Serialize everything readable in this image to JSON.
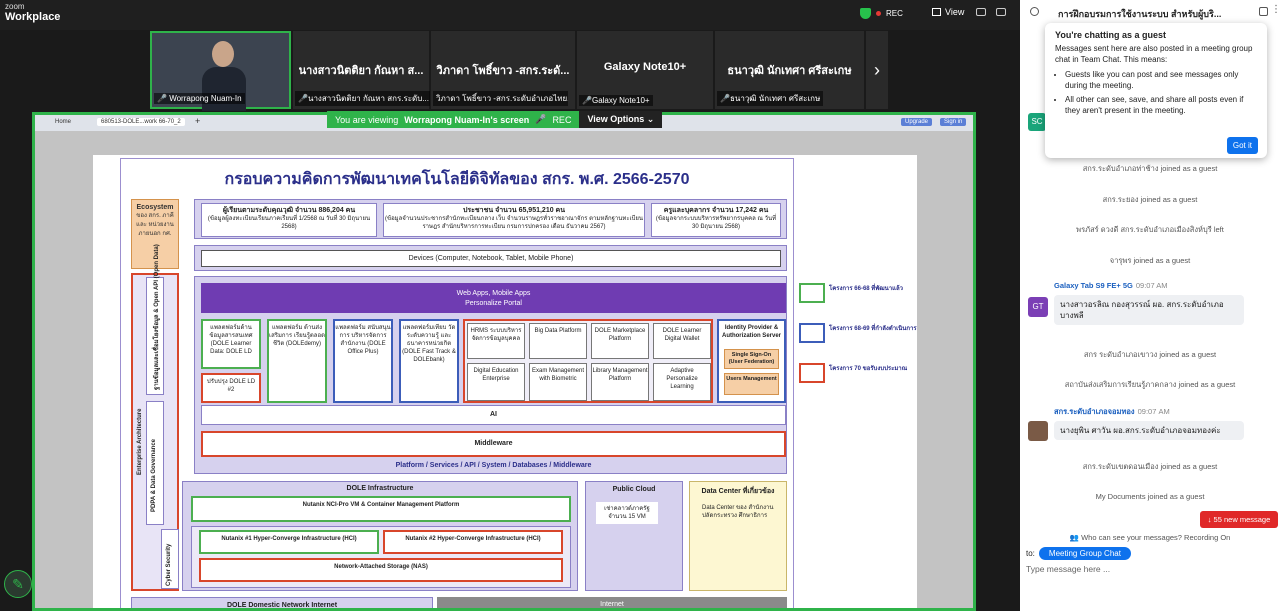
{
  "app": {
    "brand_top": "zoom",
    "brand_main": "Workplace",
    "rec_label": "REC",
    "view_label": "View"
  },
  "participants": [
    {
      "tile_name": "",
      "label": "Worrapong Nuam-In",
      "muted": false
    },
    {
      "tile_name": "นางสาวนิตติยา กัณหา ส...",
      "label": "นางสาวนิตติยา กัณหา สกร.ระดับ...",
      "muted": true
    },
    {
      "tile_name": "วิภาดา โพธิ์ขาว -สกร.ระดั...",
      "label": "วิภาดา โพธิ์ขาว -สกร.ระดับอำเภอไทย...",
      "muted": false
    },
    {
      "tile_name": "Galaxy Note10+",
      "label": "Galaxy Note10+",
      "muted": true
    },
    {
      "tile_name": "ธนาวุฒิ นักเทศา ศรีสะเกษ",
      "label": "ธนาวุฒิ นักเทศา ศรีสะเกษ",
      "muted": true
    }
  ],
  "share": {
    "viewing_prefix": "You are viewing",
    "viewing_name": "Worrapong Nuam-In's screen",
    "viewing_rec": "REC",
    "view_options": "View Options ⌄",
    "tab_home": "Home",
    "tab_doc": "680513-DOLE...work 66-70_2",
    "upgrade": "Upgrade",
    "signin": "Sign in"
  },
  "slide": {
    "title": "กรอบความคิดการพัฒนาเทคโนโลยีดิจิทัลของ สกร. พ.ศ. 2566-2570",
    "ecosystem_title": "Ecosystem",
    "ecosystem_body": "ของ สกร. ภาคี และ หน่วยงาน ภายนอก กศ.",
    "stat1_title": "ผู้เรียนตามระดับคุณวุฒิ จำนวน 886,204 คน",
    "stat1_note": "(ข้อมูลผู้ลงทะเบียนเรียนภาคเรียนที่ 1/2568 ณ วันที่ 30 มิถุนายน 2568)",
    "stat2_title": "ประชาชน จำนวน 65,951,210 คน",
    "stat2_note": "(ข้อมูลจำนวนประชากรสำนักทะเบียนกลาง เว็บ จำนวนราษฎรทั่วราชอาณาจักร ตามหลักฐานทะเบียนราษฎร สำนักบริหารการทะเบียน กรมการปกครอง เดือน ธันวาคม 2567)",
    "stat3_title": "ครูและบุคลากร จำนวน 17,242 คน",
    "stat3_note": "(ข้อมูลจากระบบบริหารทรัพยากรบุคคล ณ วันที่ 30 มิถุนายน 2568)",
    "devices": "Devices (Computer, Notebook, Tablet, Mobile Phone)",
    "left_vertical": "Enterprise Architecture",
    "mid_vertical": "ฐานข้อมูลและเชื่อมโยงข้อมูล & Open API (Open Data)",
    "pdpa_vertical": "PDPA & Data Governance",
    "cyber_vertical": "Cyber Security",
    "webapps_line1": "Web Apps, Mobile Apps",
    "webapps_line2": "Personalize Portal",
    "box_learner": "แพลตฟอร์มด้าน ข้อมูลสารสนเทศ (DOLE Learner Data: DOLE LD",
    "box_ld2": "ปรับปรุง DOLE LD #2",
    "box_edemy": "แพลตฟอร์ม ด้านส่งเสริมการ เรียนรู้ตลอดชีวิต (DOLEdemy)",
    "box_office": "แพลตฟอร์ม สนับสนุนการ บริหารจัดการ สำนักงาน (DOLE Office Plus)",
    "box_fasttrack": "แพลตฟอร์มเทียบ วัดระดับความรู้ และ ธนาคารหน่วยกิต (DOLE Fast Track & DOLEbank)",
    "box_hrms": "HRMS ระบบบริหาร จัดการข้อมูลบุคคล",
    "box_bigdata": "Big Data Platform",
    "box_marketplace": "DOLE Marketplace Platform",
    "box_wallet": "DOLE Learner Digital Wallet",
    "box_digital_ed": "Digital Education Enterprise",
    "box_exam": "Exam Management with Biometric",
    "box_library": "Library Management Platform",
    "box_adaptive": "Adaptive Personalize Learning",
    "box_idp": "Identity Provider & Authorization Server",
    "box_sso": "Single Sign-On (User Federation)",
    "box_users": "Users Management",
    "ai": "AI",
    "middleware": "Middleware",
    "platform": "Platform / Services / API / System / Databases / Middleware",
    "legend1": "โครงการ 66-68 ที่พัฒนาแล้ว",
    "legend2": "โครงการ 68-69 ที่กำลังดำเนินการ",
    "legend3": "โครงการ 70 ขอรับงบประมาณ",
    "infra_title": "DOLE Infrastructure",
    "nutanix_pro": "Nutanix NCI-Pro VM & Container Management Platform",
    "hci1": "Nutanix #1 Hyper-Converge Infrastructure (HCI)",
    "hci2": "Nutanix #2 Hyper-Converge Infrastructure (HCI)",
    "nas": "Network-Attached Storage (NAS)",
    "cloud_title": "Public Cloud",
    "cloud_body": "เช่าคลาวด์ภาครัฐ จำนวน 15 VM",
    "dc_title": "Data Center ที่เกี่ยวข้อง",
    "dc_body": "Data Center ของ สำนักงานปลัดกระทรวง ศึกษาธิการ",
    "network": "DOLE Domestic Network Internet",
    "internet": "Internet"
  },
  "chat": {
    "header_title": "การฝึกอบรมการใช้งานระบบ สำหรับผู้บริ...",
    "popover_title": "You're chatting as a guest",
    "popover_body": "Messages sent here are also posted in a meeting group chat in Team Chat. This means:",
    "popover_item1": "Guests like you can post and see messages only during the meeting.",
    "popover_item2": "All other can see, save, and share all posts even if they aren't present in the meeting.",
    "got_it": "Got it",
    "sc_avatar": "SC",
    "sys1": "สกร.ระดับอำเภอท่าช้าง joined as a guest",
    "sys2": "สกร.ระยอง joined as a guest",
    "sys3": "พรภัสร์ ดวงดี สกร.ระดับอำเภอเมืองสิงห์บุรี left",
    "sys4": "จารุพร joined as a guest",
    "msg1_sender": "Galaxy Tab S9 FE+ 5G",
    "msg1_time": "09:07 AM",
    "msg1_avatar": "GT",
    "msg1_text": "นางสาวอรลิณ กองสุวรรณ์ ผอ. สกร.ระดับอำเภอบางพลี",
    "sys5": "สกร ระดับอำเภอเขาวง joined as a guest",
    "sys6": "สถาบันส่งเสริมการเรียนรู้ภาคกลาง joined as a guest",
    "msg2_sender": "สกร.ระดับอำเภอจอมทอง",
    "msg2_time": "09:07 AM",
    "msg2_text": "นางยุพิน ศาวัน ผอ.สกร.ระดับอำเภอจอมทองค่ะ",
    "sys7": "สกร.ระดับเขตดอนเมือง joined as a guest",
    "sys8": "My Documents joined as a guest",
    "new_messages": "↓ 55 new message",
    "who_can_see": "Who can see your messages? Recording On",
    "to_label": "to:",
    "to_target": "Meeting Group Chat",
    "compose_placeholder": "Type message here ..."
  },
  "colors": {
    "green": "#2fb34a",
    "blue": "#0e72ed",
    "red": "#e02828"
  }
}
